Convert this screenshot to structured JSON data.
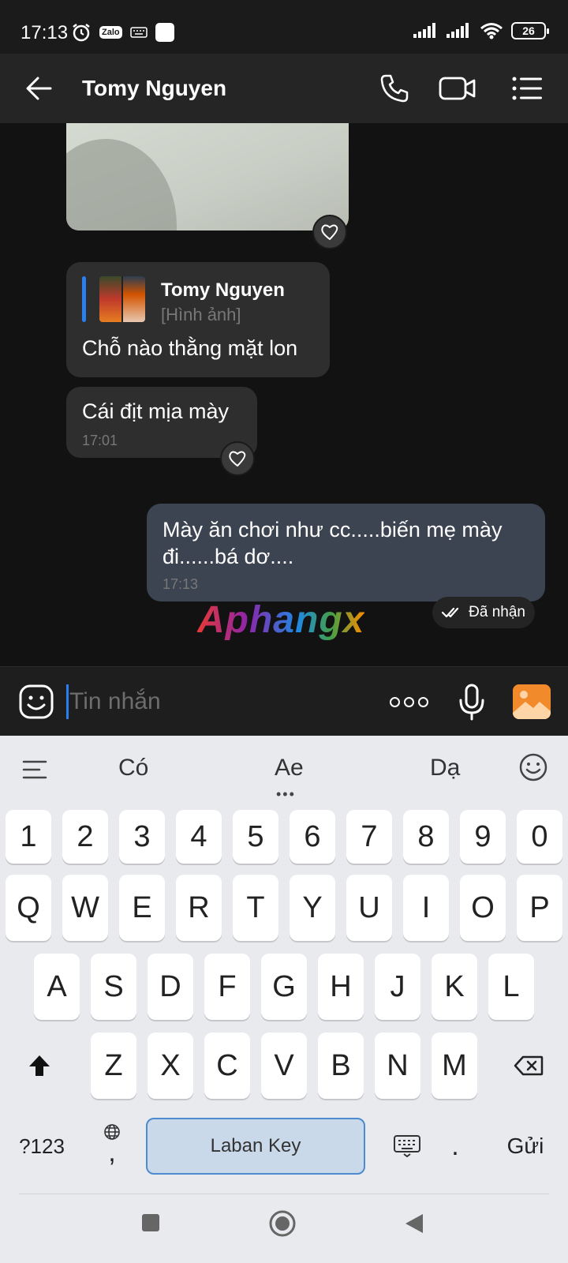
{
  "status_bar": {
    "time": "17:13",
    "zalo_label": "Zalo",
    "battery": "26"
  },
  "header": {
    "title": "Tomy Nguyen",
    "icons": [
      "back-arrow-icon",
      "phone-icon",
      "video-call-icon",
      "menu-list-icon"
    ]
  },
  "messages": [
    {
      "type": "image",
      "direction": "incoming"
    },
    {
      "type": "reply",
      "direction": "incoming",
      "quote_name": "Tomy Nguyen",
      "quote_kind": "[Hình ảnh]",
      "text": "Chỗ nào thằng mặt lon"
    },
    {
      "type": "text",
      "direction": "incoming",
      "text": "Cái địt mịa mày",
      "time": "17:01"
    },
    {
      "type": "text",
      "direction": "outgoing",
      "text": "Mày ăn chơi như cc.....biến mẹ mày đi......bá dơ....",
      "time": "17:13"
    }
  ],
  "delivery_status": "Đã nhận",
  "watermark": "Aphangx",
  "composer": {
    "placeholder": "Tin nhắn",
    "value": ""
  },
  "keyboard": {
    "suggestions": [
      "Có",
      "Ae",
      "Dạ"
    ],
    "row_numbers": [
      "1",
      "2",
      "3",
      "4",
      "5",
      "6",
      "7",
      "8",
      "9",
      "0"
    ],
    "row_top": [
      "Q",
      "W",
      "E",
      "R",
      "T",
      "Y",
      "U",
      "I",
      "O",
      "P"
    ],
    "row_home": [
      "A",
      "S",
      "D",
      "F",
      "G",
      "H",
      "J",
      "K",
      "L"
    ],
    "row_bottom": [
      "Z",
      "X",
      "C",
      "V",
      "B",
      "N",
      "M"
    ],
    "symbols_key": "?123",
    "comma_key": ",",
    "space_label": "Laban Key",
    "period_key": ".",
    "send_key": "Gửi"
  },
  "colors": {
    "accent_blue": "#2a7ef0",
    "outgoing_bubble": "#3d4451",
    "incoming_bubble": "#2e2e2e",
    "image_button": "#f08a2a"
  }
}
